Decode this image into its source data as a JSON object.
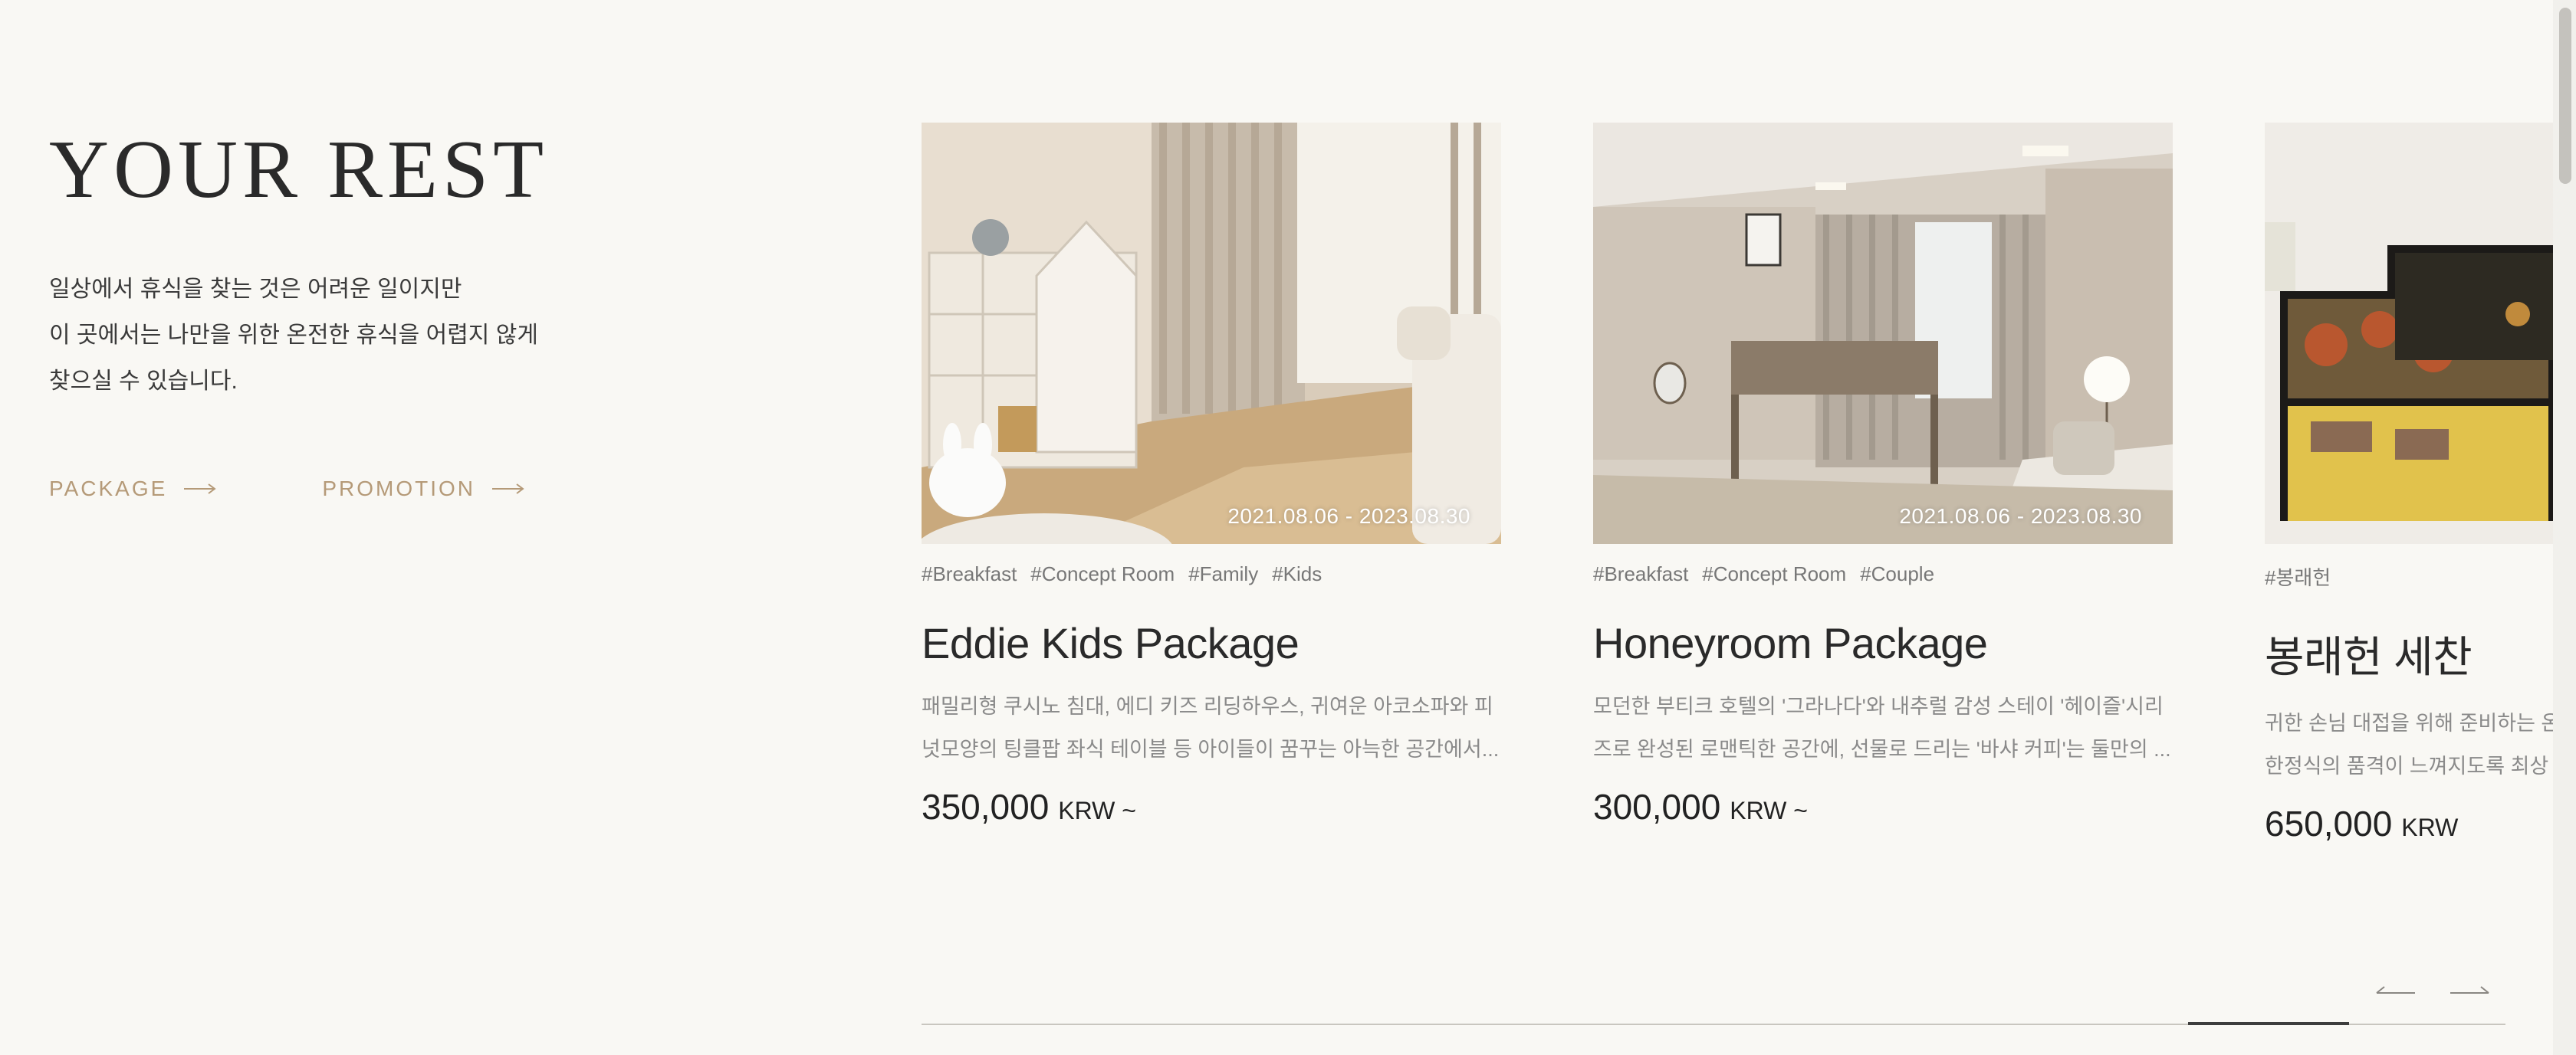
{
  "intro": {
    "title": "YOUR REST",
    "description_lines": [
      "일상에서 휴식을 찾는 것은 어려운 일이지만",
      "이 곳에서는 나만을 위한 온전한 휴식을 어렵지 않게",
      "찾으실 수 있습니다."
    ],
    "links": [
      {
        "label": "PACKAGE"
      },
      {
        "label": "PROMOTION"
      }
    ]
  },
  "cards": [
    {
      "image_icon": "kids-room-photo",
      "date": "2021.08.06 - 2023.08.30",
      "tags": [
        "#Breakfast",
        "#Concept Room",
        "#Family",
        "#Kids"
      ],
      "title": "Eddie Kids Package",
      "desc_lines": [
        "패밀리형 쿠시노 침대, 에디 키즈 리딩하우스, 귀여운 아코소파와 피",
        "넛모양의 팅클팝 좌식 테이블 등 아이들이 꿈꾸는 아늑한 공간에서..."
      ],
      "price": "350,000",
      "price_unit": "KRW ~"
    },
    {
      "image_icon": "honeyroom-photo",
      "date": "2021.08.06 - 2023.08.30",
      "tags": [
        "#Breakfast",
        "#Concept Room",
        "#Couple"
      ],
      "title": "Honeyroom Package",
      "desc_lines": [
        "모던한 부티크 호텔의 '그라나다'와 내추럴 감성 스테이 '헤이즐'시리",
        "즈로 완성된 로맨틱한 공간에, 선물로 드리는 '바샤 커피'는 둘만의 ..."
      ],
      "price": "300,000",
      "price_unit": "KRW ~"
    },
    {
      "image_icon": "korean-food-photo",
      "date": "",
      "tags": [
        "#봉래헌"
      ],
      "title": "봉래헌 세찬",
      "desc_lines": [
        "귀한 손님 대접을 위해 준비하는 온",
        "한정식의 품격이 느껴지도록 최상"
      ],
      "price": "650,000",
      "price_unit": "KRW"
    }
  ],
  "navigation": {
    "prev_icon": "arrow-left-icon",
    "next_icon": "arrow-right-icon"
  },
  "colors": {
    "background": "#f9f8f4",
    "accent": "#b59a78",
    "text": "#2a2a2a",
    "muted": "#8a8a8a"
  }
}
